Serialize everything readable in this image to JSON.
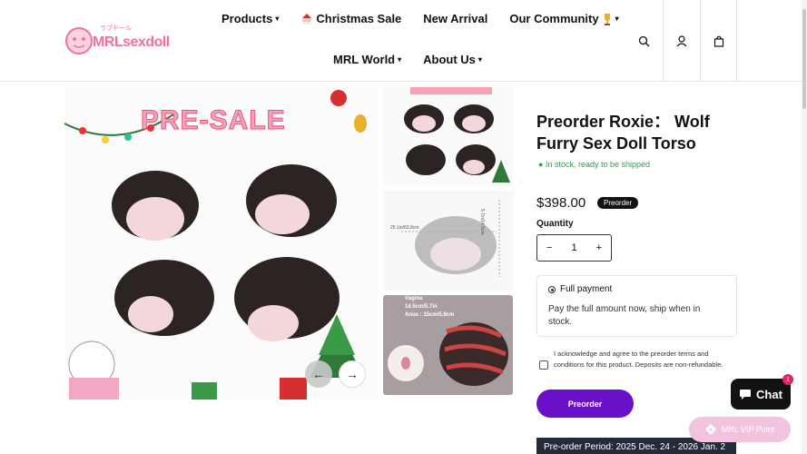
{
  "brand": {
    "name": "MRLsexdoll",
    "tagline": "ラブドール"
  },
  "nav": {
    "row1": [
      {
        "label": "Products",
        "dropdown": true
      },
      {
        "label": "Christmas Sale",
        "dropdown": false
      },
      {
        "label": "New Arrival",
        "dropdown": false
      },
      {
        "label": "Our Community",
        "dropdown": true
      }
    ],
    "row2": [
      {
        "label": "MRL World",
        "dropdown": true
      },
      {
        "label": "About Us",
        "dropdown": true
      }
    ]
  },
  "gallery": {
    "banner": "PRE-SALE",
    "thumb2_dim_a": "25.1in/63.8cm",
    "thumb2_dim_b": "5.7in/14.5cm",
    "thumb3_line1": "Vagina",
    "thumb3_line2": "14.5cm/5.7in",
    "thumb3_line3": "Anus : 15cm/5.9cm"
  },
  "product": {
    "title": "Preorder Roxie： Wolf Furry Sex Doll Torso",
    "stock": "In stock, ready to be shipped",
    "price": "$398.00",
    "badge": "Preorder",
    "quantity_label": "Quantity",
    "quantity": "1",
    "payment_title": "Full payment",
    "payment_desc": "Pay the full amount now, ship when in stock.",
    "terms": "I acknowledge and agree to the preorder terms and conditions for this product. Deposits are non-refundable.",
    "button": "Preorder",
    "period": "Pre-order Period: 2025 Dec. 24 - 2026 Jan. 2"
  },
  "widgets": {
    "chat": "Chat",
    "chat_count": "1",
    "vip": "MRL VIP Point"
  },
  "colors": {
    "accent": "#6a10c8",
    "brand_pink": "#f0729a",
    "stock_green": "#2e9e4a"
  }
}
